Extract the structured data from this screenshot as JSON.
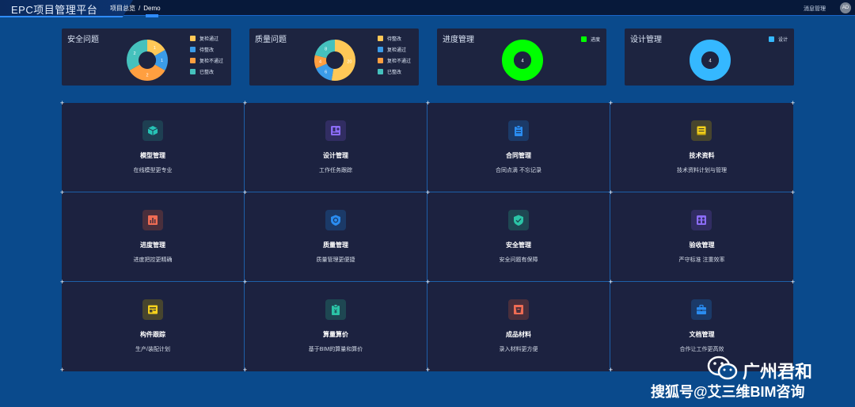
{
  "header": {
    "app_title": "EPC项目管理平台",
    "breadcrumb": [
      "项目总览",
      "Demo"
    ],
    "messages_label": "消息管理",
    "avatar_initials": "AD"
  },
  "stats": [
    {
      "title": "安全问题",
      "legend": [
        {
          "label": "复检通过",
          "color": "#ffc857"
        },
        {
          "label": "待整改",
          "color": "#3b9ce8"
        },
        {
          "label": "复检不通过",
          "color": "#ff9f40"
        },
        {
          "label": "已整改",
          "color": "#45c1bd"
        }
      ],
      "slices": [
        {
          "value": 1,
          "color": "#ffc857"
        },
        {
          "value": 1,
          "color": "#3b9ce8"
        },
        {
          "value": 2,
          "color": "#ff9f40"
        },
        {
          "value": 2,
          "color": "#45c1bd"
        }
      ]
    },
    {
      "title": "质量问题",
      "legend": [
        {
          "label": "待整改",
          "color": "#ffc857"
        },
        {
          "label": "复检通过",
          "color": "#3b9ce8"
        },
        {
          "label": "复检不通过",
          "color": "#ff9f40"
        },
        {
          "label": "已整改",
          "color": "#45c1bd"
        }
      ],
      "slices": [
        {
          "value": 20,
          "color": "#ffc857"
        },
        {
          "value": 6,
          "color": "#3b9ce8"
        },
        {
          "value": 4,
          "color": "#ff9f40"
        },
        {
          "value": 8,
          "color": "#45c1bd"
        }
      ]
    },
    {
      "title": "进度管理",
      "legend": [
        {
          "label": "进度",
          "color": "#00ff00"
        }
      ],
      "slices": [
        {
          "value": 4,
          "color": "#00ff00"
        }
      ],
      "center_value": "4"
    },
    {
      "title": "设计管理",
      "legend": [
        {
          "label": "设计",
          "color": "#35b8ff"
        }
      ],
      "slices": [
        {
          "value": 4,
          "color": "#35b8ff"
        }
      ],
      "center_value": "4"
    }
  ],
  "modules": [
    {
      "title": "模型管理",
      "subtitle": "在线模型更专业",
      "icon": "cube-icon",
      "color": "#27c3b5",
      "bg": "#1e3f52"
    },
    {
      "title": "设计管理",
      "subtitle": "工作任务跟踪",
      "icon": "design-icon",
      "color": "#8b6cf6",
      "bg": "#312d62"
    },
    {
      "title": "合同管理",
      "subtitle": "合同点滴 不忘记录",
      "icon": "clipboard-icon",
      "color": "#2a8cf0",
      "bg": "#1b3a68"
    },
    {
      "title": "技术资料",
      "subtitle": "技术资料计划与管理",
      "icon": "book-icon",
      "color": "#f6d21c",
      "bg": "#47452e"
    },
    {
      "title": "进度管理",
      "subtitle": "进度把控更精确",
      "icon": "chart-icon",
      "color": "#ef6c54",
      "bg": "#4a2f3c"
    },
    {
      "title": "质量管理",
      "subtitle": "质量管理更便捷",
      "icon": "shield-icon",
      "color": "#2a8cf0",
      "bg": "#1b3a68"
    },
    {
      "title": "安全管理",
      "subtitle": "安全问题有保障",
      "icon": "check-shield-icon",
      "color": "#2bc4a6",
      "bg": "#1e4752"
    },
    {
      "title": "验收管理",
      "subtitle": "严守标准 注重效率",
      "icon": "people-icon",
      "color": "#8b6cf6",
      "bg": "#312d62"
    },
    {
      "title": "构件跟踪",
      "subtitle": "生产/装配计划",
      "icon": "panel-icon",
      "color": "#f6d21c",
      "bg": "#47452e"
    },
    {
      "title": "算量算价",
      "subtitle": "基于BIM的算量和算价",
      "icon": "price-icon",
      "color": "#2bc4a6",
      "bg": "#1e4752"
    },
    {
      "title": "成品材料",
      "subtitle": "录入材料更方便",
      "icon": "material-icon",
      "color": "#ef6c54",
      "bg": "#4a2f3c"
    },
    {
      "title": "文档管理",
      "subtitle": "合作让工作更高效",
      "icon": "briefcase-icon",
      "color": "#2a8cf0",
      "bg": "#1b3a68"
    }
  ],
  "watermark": {
    "brand": "广州君和",
    "source": "搜狐号@艾三维BIM咨询"
  }
}
